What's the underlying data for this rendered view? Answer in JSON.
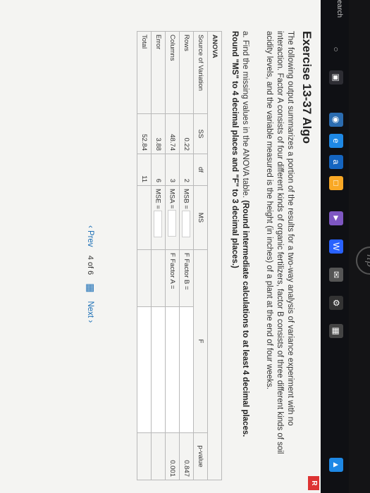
{
  "exercise": {
    "title": "Exercise 13-37 Algo",
    "prompt": "The following output summarizes a portion of the results for a two-way analysis of variance experiment with no interaction. Factor A consists of four different kinds of organic fertilizers, factor B consists of three different kinds of soil acidity levels, and the variable measured is the height (in inches) of a plant at the end of four weeks.",
    "instruction_lead": "a. Find the missing values in the ANOVA table.",
    "instruction_bold": "(Round intermediate calculations to at least 4 decimal places. Round \"MS\" to 4 decimal places and \"F\" to 3 decimal places.)"
  },
  "anova": {
    "title": "ANOVA",
    "headers": [
      "Source of Variation",
      "SS",
      "df",
      "MS",
      "F",
      "p-value"
    ],
    "rows": [
      {
        "source": "Rows",
        "ss": "0.22",
        "df": "2",
        "ms": "MSB =",
        "f": "F Factor B =",
        "p": "0.847"
      },
      {
        "source": "Columns",
        "ss": "48.74",
        "df": "3",
        "ms": "MSA =",
        "f": "F Factor A =",
        "p": "0.001"
      },
      {
        "source": "Error",
        "ss": "3.88",
        "df": "6",
        "ms": "MSE =",
        "f": "",
        "p": ""
      },
      {
        "source": "Total",
        "ss": "52.84",
        "df": "11",
        "ms": "",
        "f": "",
        "p": ""
      }
    ]
  },
  "pager": {
    "prev": "Prev",
    "current": "4",
    "of": "of",
    "total": "6",
    "next": "Next"
  },
  "taskbar": {
    "search": "earch"
  },
  "badge": "R",
  "logo": "hp"
}
